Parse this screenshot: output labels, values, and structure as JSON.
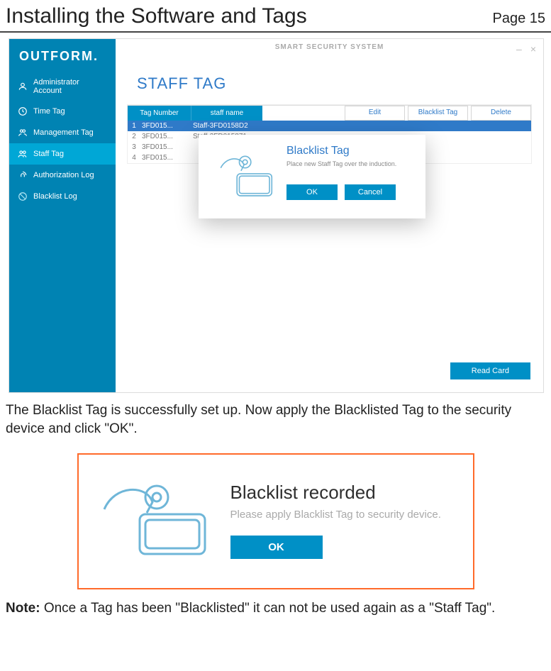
{
  "doc": {
    "title": "Installing the Software and Tags",
    "page_label": "Page 15"
  },
  "app": {
    "brand": "OUTFORM.",
    "title": "SMART SECURITY SYSTEM",
    "window": {
      "minimize": "–",
      "close": "×"
    }
  },
  "sidebar": {
    "items": [
      {
        "label": "Administrator Account",
        "icon": "user-icon"
      },
      {
        "label": "Time Tag",
        "icon": "clock-icon"
      },
      {
        "label": "Management Tag",
        "icon": "tag-icon"
      },
      {
        "label": "Staff Tag",
        "icon": "people-icon"
      },
      {
        "label": "Authorization Log",
        "icon": "fingerprint-icon"
      },
      {
        "label": "Blacklist Log",
        "icon": "blocked-icon"
      }
    ]
  },
  "main": {
    "section_title": "STAFF TAG",
    "columns": {
      "num": "Tag Number",
      "name": "staff name"
    },
    "actions": {
      "edit": "Edit",
      "blacklist": "Blacklist Tag",
      "delete": "Delete"
    },
    "rows": [
      {
        "idx": "1",
        "num": "3FD015...",
        "name": "Staff-3FD0158D2",
        "selected": true
      },
      {
        "idx": "2",
        "num": "3FD015...",
        "name": "Staff-3FD015871"
      },
      {
        "idx": "3",
        "num": "3FD015...",
        "name": ""
      },
      {
        "idx": "4",
        "num": "3FD015...",
        "name": ""
      }
    ],
    "read_card": "Read Card"
  },
  "modal": {
    "title": "Blacklist Tag",
    "subtitle": "Place new Staff Tag over the induction.",
    "ok": "OK",
    "cancel": "Cancel"
  },
  "para1": "The Blacklist Tag is successfully set up. Now apply the Blacklisted Tag to the security device and click \"OK\".",
  "dialog2": {
    "title": "Blacklist recorded",
    "subtitle": "Please apply Blacklist Tag to security device.",
    "ok": "OK"
  },
  "note": {
    "prefix": "Note:",
    "body": " Once a Tag has been \"Blacklisted\" it can not be used again as a \"Staff Tag\"."
  }
}
